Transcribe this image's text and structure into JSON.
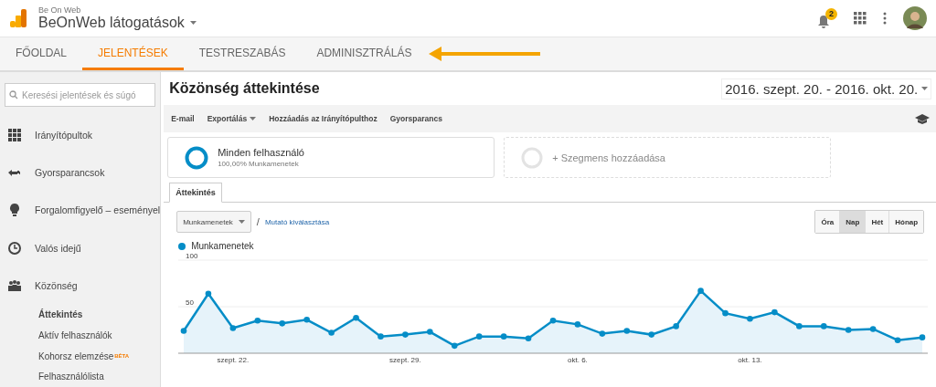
{
  "header": {
    "account": "Be On Web",
    "property": "BeOnWeb látogatások",
    "notifications": "2"
  },
  "nav_tabs": [
    {
      "label": "FŐOLDAL",
      "selected": false
    },
    {
      "label": "JELENTÉSEK",
      "selected": true
    },
    {
      "label": "TESTRESZABÁS",
      "selected": false
    },
    {
      "label": "ADMINISZTRÁLÁS",
      "selected": false
    }
  ],
  "sidebar": {
    "search": {
      "placeholder": "Keresési jelentések és súgó"
    },
    "items": [
      {
        "label": "Irányítópultok"
      },
      {
        "label": "Gyorsparancsok"
      },
      {
        "label": "Forgalomfigyelő – eseményel"
      },
      {
        "label": "Valós idejű"
      },
      {
        "label": "Közönség",
        "children": [
          {
            "label": "Áttekintés",
            "selected": true
          },
          {
            "label": "Aktív felhasználók",
            "selected": false
          },
          {
            "label": "Kohorsz elemzése",
            "badge": "BÉTA",
            "selected": false
          },
          {
            "label": "Felhasználólista",
            "selected": false
          }
        ]
      }
    ]
  },
  "report": {
    "title": "Közönség áttekintése",
    "date_range": "2016. szept. 20. - 2016. okt. 20.",
    "actions": [
      {
        "label": "E-mail",
        "dropdown": false
      },
      {
        "label": "Exportálás",
        "dropdown": true
      },
      {
        "label": "Hozzáadás az Irányítópulthoz",
        "dropdown": false
      },
      {
        "label": "Gyorsparancs",
        "dropdown": false
      }
    ],
    "segments": [
      {
        "kind": "active",
        "name": "Minden felhasználó",
        "detail": "100,00% Munkamenetek"
      },
      {
        "kind": "add",
        "name": "+ Szegmens hozzáadása"
      }
    ],
    "tabs": [
      {
        "label": "Áttekintés",
        "selected": true
      }
    ],
    "metric": "Munkamenetek",
    "separator": "/",
    "metric_link": "Mutató kiválasztása",
    "periods": [
      {
        "label": "Óra",
        "selected": false
      },
      {
        "label": "Nap",
        "selected": true
      },
      {
        "label": "Hét",
        "selected": false
      },
      {
        "label": "Hónap",
        "selected": false
      }
    ],
    "chart_data": {
      "type": "area",
      "categories": [
        null,
        null,
        "szept. 22.",
        null,
        null,
        null,
        null,
        null,
        null,
        "szept. 29.",
        null,
        null,
        null,
        null,
        null,
        null,
        "okt. 6.",
        null,
        null,
        null,
        null,
        null,
        null,
        "okt. 13.",
        null,
        null,
        null,
        null,
        null,
        null,
        null
      ],
      "series": [
        {
          "name": "Munkamenetek",
          "color": "#058dc7",
          "values": [
            24,
            64,
            27,
            35,
            32,
            36,
            22,
            38,
            18,
            20,
            23,
            8,
            18,
            18,
            16,
            35,
            31,
            21,
            24,
            20,
            29,
            67,
            43,
            37,
            44,
            29,
            29,
            25,
            26,
            14,
            17
          ]
        }
      ],
      "ylim": [
        0,
        100
      ],
      "yticks": [
        50,
        100
      ]
    }
  }
}
